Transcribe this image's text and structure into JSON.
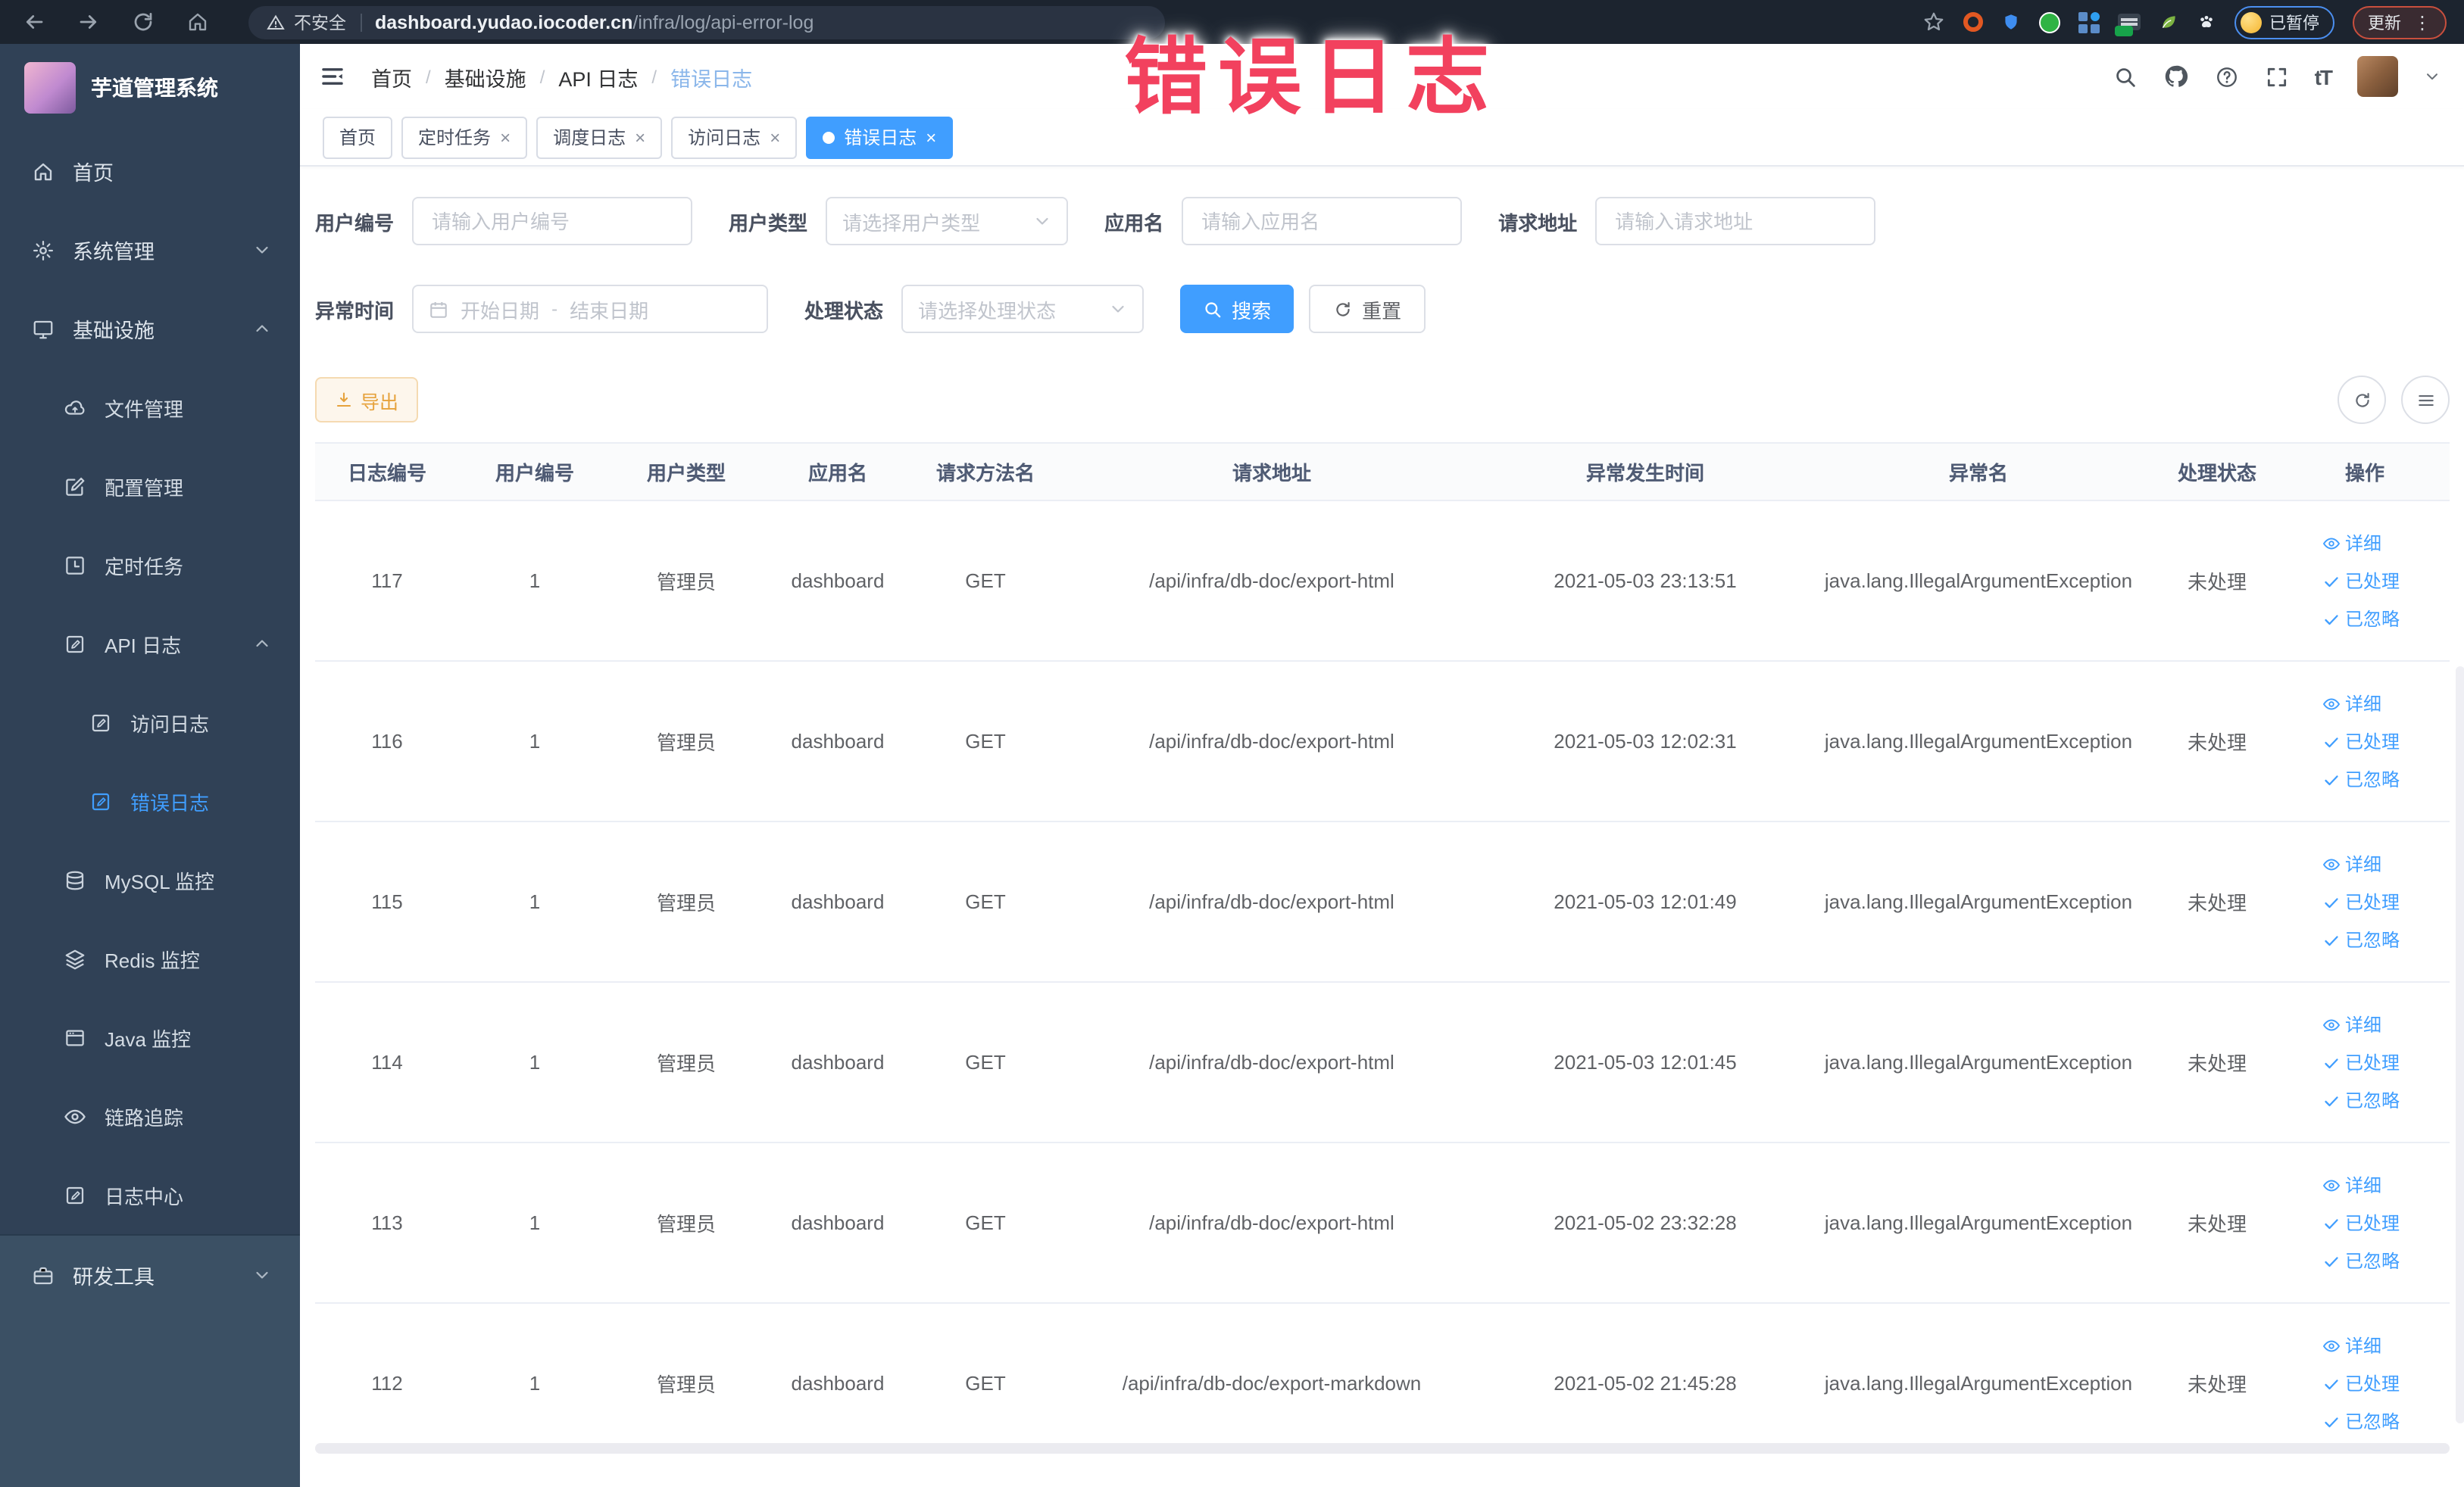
{
  "browser": {
    "security": "不安全",
    "host": "dashboard.yudao.iocoder.cn",
    "path": "/infra/log/api-error-log",
    "profile_badge": "已暂停",
    "update_label": "更新"
  },
  "overlay": {
    "text": "错误日志"
  },
  "colors": {
    "primary": "#409eff",
    "sidebar_bg": "#304156",
    "overlay_red": "#f2415e",
    "warning": "#e6a23c",
    "tab_active": "#409eff"
  },
  "sidebar": {
    "title": "芋道管理系统",
    "menu": [
      "首页",
      "系统管理",
      "基础设施",
      "文件管理",
      "配置管理",
      "定时任务",
      "API 日志",
      "访问日志",
      "错误日志",
      "MySQL 监控",
      "Redis 监控",
      "Java 监控",
      "链路追踪",
      "日志中心",
      "研发工具"
    ]
  },
  "breadcrumb": [
    "首页",
    "基础设施",
    "API 日志",
    "错误日志"
  ],
  "tabs": [
    "首页",
    "定时任务",
    "调度日志",
    "访问日志",
    "错误日志"
  ],
  "filters": {
    "user_id_label": "用户编号",
    "user_id_placeholder": "请输入用户编号",
    "user_type_label": "用户类型",
    "user_type_placeholder": "请选择用户类型",
    "app_name_label": "应用名",
    "app_name_placeholder": "请输入应用名",
    "request_url_label": "请求地址",
    "request_url_placeholder": "请输入请求地址",
    "time_label": "异常时间",
    "time_start_placeholder": "开始日期",
    "time_separator": "-",
    "time_end_placeholder": "结束日期",
    "status_label": "处理状态",
    "status_placeholder": "请选择处理状态",
    "search_label": "搜索",
    "reset_label": "重置"
  },
  "toolbar": {
    "export_label": "导出"
  },
  "table": {
    "columns": [
      "日志编号",
      "用户编号",
      "用户类型",
      "应用名",
      "请求方法名",
      "请求地址",
      "异常发生时间",
      "异常名",
      "处理状态",
      "操作"
    ],
    "action_labels": [
      "详细",
      "已处理",
      "已忽略"
    ],
    "rows": [
      [
        "117",
        "1",
        "管理员",
        "dashboard",
        "GET",
        "/api/infra/db-doc/export-html",
        "2021-05-03 23:13:51",
        "java.lang.IllegalArgumentException",
        "未处理"
      ],
      [
        "116",
        "1",
        "管理员",
        "dashboard",
        "GET",
        "/api/infra/db-doc/export-html",
        "2021-05-03 12:02:31",
        "java.lang.IllegalArgumentException",
        "未处理"
      ],
      [
        "115",
        "1",
        "管理员",
        "dashboard",
        "GET",
        "/api/infra/db-doc/export-html",
        "2021-05-03 12:01:49",
        "java.lang.IllegalArgumentException",
        "未处理"
      ],
      [
        "114",
        "1",
        "管理员",
        "dashboard",
        "GET",
        "/api/infra/db-doc/export-html",
        "2021-05-03 12:01:45",
        "java.lang.IllegalArgumentException",
        "未处理"
      ],
      [
        "113",
        "1",
        "管理员",
        "dashboard",
        "GET",
        "/api/infra/db-doc/export-html",
        "2021-05-02 23:32:28",
        "java.lang.IllegalArgumentException",
        "未处理"
      ],
      [
        "112",
        "1",
        "管理员",
        "dashboard",
        "GET",
        "/api/infra/db-doc/export-markdown",
        "2021-05-02 21:45:28",
        "java.lang.IllegalArgumentException",
        "未处理"
      ]
    ]
  }
}
